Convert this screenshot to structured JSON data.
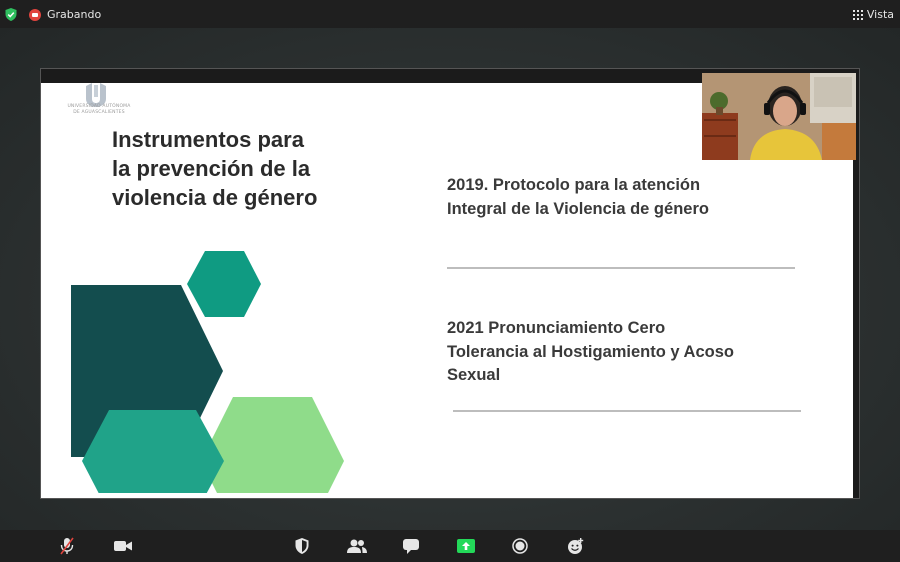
{
  "topbar": {
    "recording_label": "Grabando",
    "view_label": "Vista",
    "security_icon": "shield-check-icon",
    "record_icon": "record-icon",
    "view_icon": "grid-icon"
  },
  "slide": {
    "logo_caption_line1": "UNIVERSIDAD AUTÓNOMA",
    "logo_caption_line2": "DE AGUASCALIENTES",
    "title": "Instrumentos para\nla prevención de la\nviolencia de género",
    "item1": "2019. Protocolo para la atención\nIntegral de la Violencia de género",
    "item2": "2021 Pronunciamiento Cero\nTolerancia al Hostigamiento y Acoso\nSexual",
    "colors": {
      "dark_teal": "#134d4e",
      "teal": "#0f9b82",
      "teal_light": "#20a389",
      "light_green": "#8fdc8a"
    }
  },
  "toolbar": {
    "icons": [
      "microphone-muted-icon",
      "video-camera-icon",
      "security-shield-icon",
      "participants-icon",
      "chat-icon",
      "share-screen-icon",
      "record-icon",
      "reactions-icon"
    ],
    "accent": "#23d959"
  }
}
